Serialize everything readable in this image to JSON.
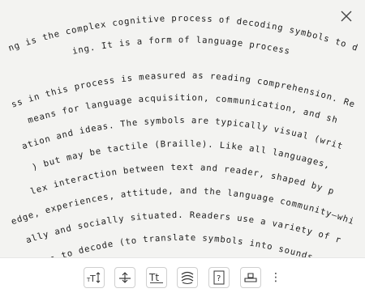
{
  "reader": {
    "lines": [
      "Reading is the complex cognitive process of decoding symbols to derive",
      "meaning. It is a form of language processing.",
      "Success in this process is measured as reading comprehension. Reading",
      "is a means for language acquisition, communication, and sharing",
      "information and ideas. The symbols are typically visual (written or",
      "printed) but may be tactile (Braille). Like all languages, it is a",
      "complex interaction between text and reader, shaped by prior",
      "knowledge, experiences, attitude, and the language community—which is",
      "culturally and socially situated. Readers use a variety of reading",
      "strategies to decode (to translate symbols into sounds or visual"
    ]
  },
  "close_button": {
    "label": "Close",
    "icon": "close-icon"
  },
  "toolbar": {
    "buttons": [
      {
        "name": "text-size-button",
        "icon": "text-size-icon"
      },
      {
        "name": "line-spacing-button",
        "icon": "line-spacing-icon"
      },
      {
        "name": "font-button",
        "icon": "font-style-icon",
        "glyph": "Tt"
      },
      {
        "name": "text-effects-button",
        "icon": "text-effects-icon"
      },
      {
        "name": "help-button",
        "icon": "help-icon",
        "glyph": "?"
      },
      {
        "name": "stamp-button",
        "icon": "stamp-icon"
      }
    ],
    "more": "⋮"
  },
  "colors": {
    "background": "#f3f3f1",
    "text": "#1b1b1b",
    "toolbar": "#ffffff"
  }
}
